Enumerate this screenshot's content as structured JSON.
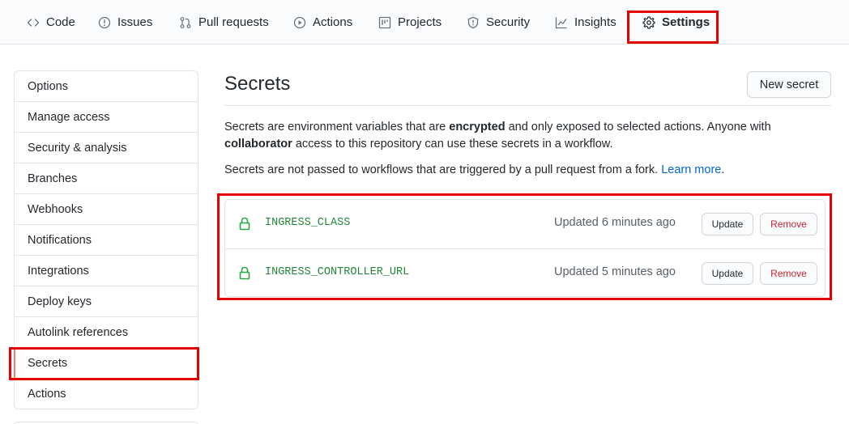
{
  "nav": {
    "tabs": [
      {
        "label": "Code",
        "icon": "code-icon"
      },
      {
        "label": "Issues",
        "icon": "issue-icon"
      },
      {
        "label": "Pull requests",
        "icon": "pull-request-icon"
      },
      {
        "label": "Actions",
        "icon": "play-icon"
      },
      {
        "label": "Projects",
        "icon": "project-icon"
      },
      {
        "label": "Security",
        "icon": "shield-icon"
      },
      {
        "label": "Insights",
        "icon": "graph-icon"
      },
      {
        "label": "Settings",
        "icon": "gear-icon",
        "selected": true
      }
    ]
  },
  "sidebar": {
    "items": [
      {
        "label": "Options"
      },
      {
        "label": "Manage access"
      },
      {
        "label": "Security & analysis"
      },
      {
        "label": "Branches"
      },
      {
        "label": "Webhooks"
      },
      {
        "label": "Notifications"
      },
      {
        "label": "Integrations"
      },
      {
        "label": "Deploy keys"
      },
      {
        "label": "Autolink references"
      },
      {
        "label": "Secrets",
        "selected": true
      },
      {
        "label": "Actions"
      }
    ]
  },
  "main": {
    "title": "Secrets",
    "new_secret_label": "New secret",
    "desc1": {
      "a": "Secrets are environment variables that are ",
      "b": "encrypted",
      "c": " and only exposed to selected actions. Anyone with ",
      "d": "collaborator",
      "e": " access to this repository can use these secrets in a workflow."
    },
    "desc2": {
      "text": "Secrets are not passed to workflows that are triggered by a pull request from a fork. ",
      "link": "Learn more",
      "end": "."
    },
    "secrets": [
      {
        "name": "INGRESS_CLASS",
        "updated": "Updated 6 minutes ago",
        "update_label": "Update",
        "remove_label": "Remove"
      },
      {
        "name": "INGRESS_CONTROLLER_URL",
        "updated": "Updated 5 minutes ago",
        "update_label": "Update",
        "remove_label": "Remove"
      }
    ]
  },
  "colors": {
    "highlight": "#e60000",
    "secret_name": "#22863a",
    "remove": "#cb2431",
    "link": "#0366d6",
    "selected_marker": "#f9826c"
  }
}
